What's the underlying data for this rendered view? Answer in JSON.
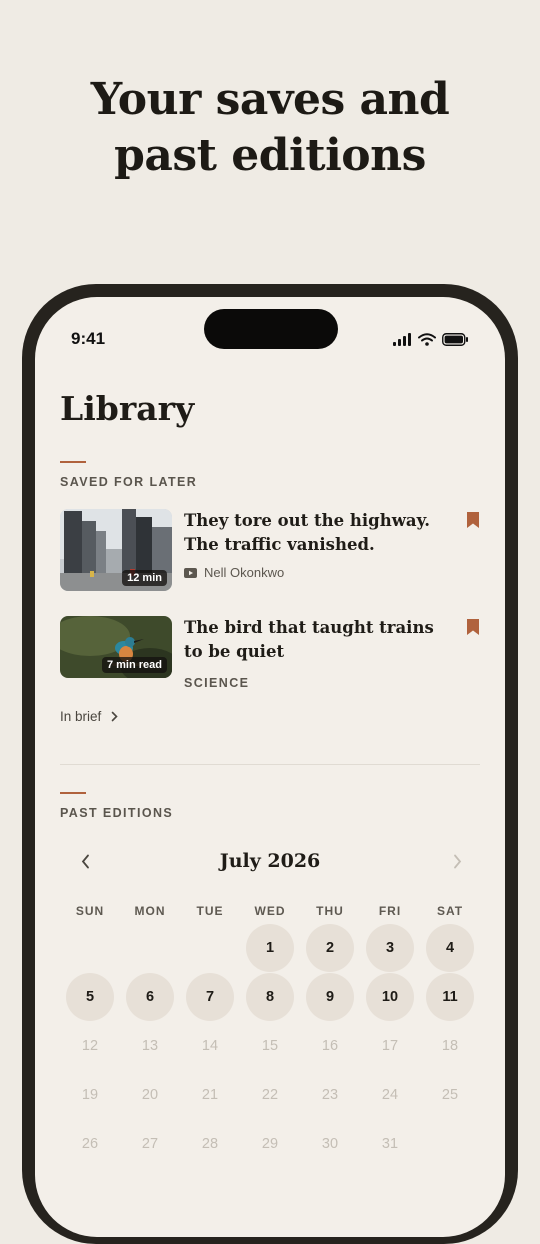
{
  "headline": {
    "line1": "Your saves and",
    "line2": "past editions"
  },
  "status_bar": {
    "time": "9:41"
  },
  "library": {
    "title": "Library",
    "saved_label": "SAVED FOR LATER",
    "items": [
      {
        "title": "They tore out the highway. The traffic vanished.",
        "badge": "12 min",
        "author": "Nell Okonkwo",
        "media_icon": "video-icon"
      },
      {
        "title": "The bird that taught trains to be quiet",
        "badge": "7 min read",
        "tag": "SCIENCE"
      }
    ],
    "in_brief": "In brief",
    "past_label": "PAST EDITIONS"
  },
  "calendar": {
    "month": "July 2026",
    "weekdays": [
      "SUN",
      "MON",
      "TUE",
      "WED",
      "THU",
      "FRI",
      "SAT"
    ],
    "days": [
      "1",
      "2",
      "3",
      "4",
      "5",
      "6",
      "7",
      "8",
      "9",
      "10",
      "11",
      "12",
      "13",
      "14",
      "15",
      "16",
      "17",
      "18",
      "19",
      "20",
      "21",
      "22",
      "23",
      "24",
      "25",
      "26",
      "27",
      "28",
      "29",
      "30",
      "31"
    ],
    "available_through": 11,
    "first_weekday_index": 3
  },
  "colors": {
    "accent": "#b0623d",
    "background": "#efebe4",
    "screen": "#f3efe9",
    "bezel": "#26231e"
  }
}
